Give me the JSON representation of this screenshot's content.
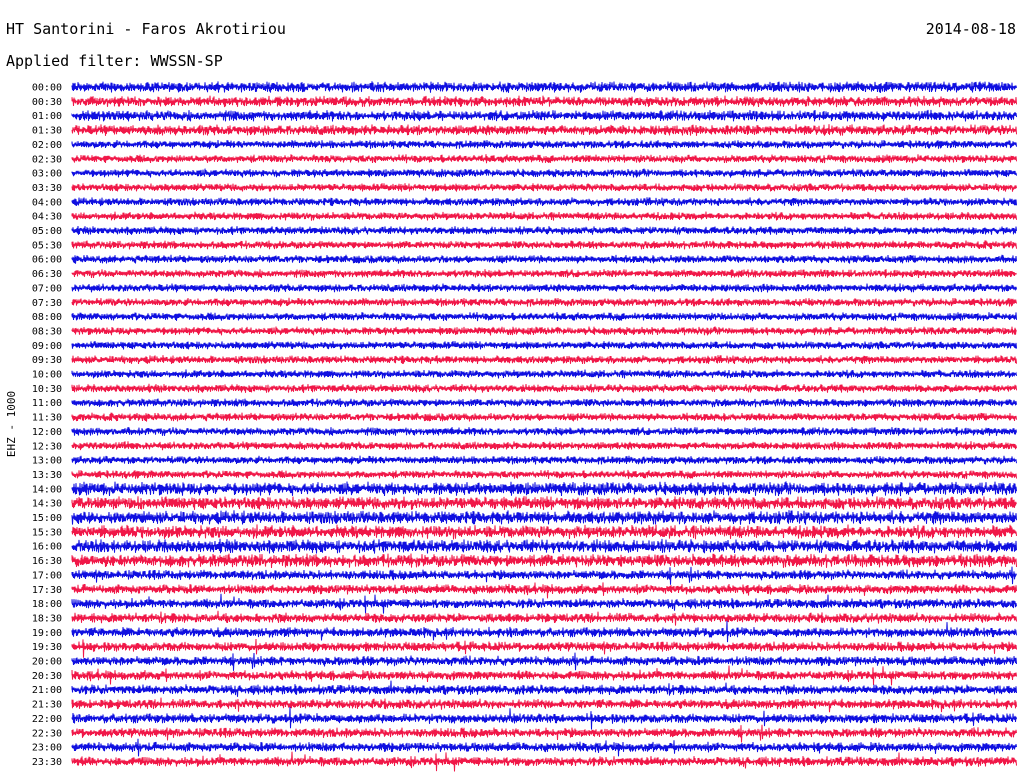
{
  "header": {
    "station": "HT Santorini - Faros Akrotiriou",
    "date": "2014-08-18",
    "filter_label": "Applied filter: WWSSN-SP",
    "channel_label": "EHZ - 1000"
  },
  "colors": {
    "trace_a": "#1010e0",
    "trace_b": "#f01848"
  },
  "chart_data": {
    "type": "helicorder",
    "title": "HT Santorini - Faros Akrotiriou",
    "date": "2014-08-18",
    "filter": "WWSSN-SP",
    "ylabel": "EHZ - 1000",
    "row_interval_minutes": 30,
    "rows": [
      "00:00",
      "00:30",
      "01:00",
      "01:30",
      "02:00",
      "02:30",
      "03:00",
      "03:30",
      "04:00",
      "04:30",
      "05:00",
      "05:30",
      "06:00",
      "06:30",
      "07:00",
      "07:30",
      "08:00",
      "08:30",
      "09:00",
      "09:30",
      "10:00",
      "10:30",
      "11:00",
      "11:30",
      "12:00",
      "12:30",
      "13:00",
      "13:30",
      "14:00",
      "14:30",
      "15:00",
      "15:30",
      "16:00",
      "16:30",
      "17:00",
      "17:30",
      "18:00",
      "18:30",
      "19:00",
      "19:30",
      "20:00",
      "20:30",
      "21:00",
      "21:30",
      "22:00",
      "22:30",
      "23:00",
      "23:30"
    ],
    "row_colors": [
      "#1010e0",
      "#f01848"
    ]
  }
}
